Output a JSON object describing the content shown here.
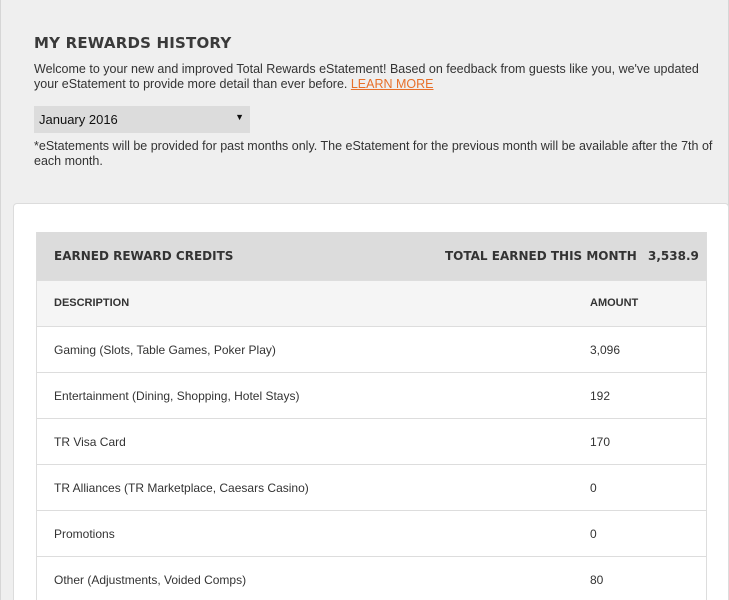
{
  "header": {
    "title": "MY REWARDS HISTORY"
  },
  "intro": {
    "text": "Welcome to your new and improved Total Rewards eStatement! Based on feedback from guests like you, we've updated your eStatement to provide more detail than ever before. ",
    "link_label": "LEARN MORE"
  },
  "month_select": {
    "value": "January 2016",
    "arrow_icon": "caret-down-icon"
  },
  "note": "*eStatements will be provided for past months only. The eStatement for the previous month will be available after the 7th of each month.",
  "earned": {
    "section_title": "EARNED REWARD CREDITS",
    "total_label": "TOTAL EARNED THIS MONTH",
    "total_value": "3,538.9",
    "columns": {
      "description": "DESCRIPTION",
      "amount": "AMOUNT"
    },
    "rows": [
      {
        "description": "Gaming (Slots, Table Games, Poker Play)",
        "amount": "3,096"
      },
      {
        "description": "Entertainment (Dining, Shopping, Hotel Stays)",
        "amount": "192"
      },
      {
        "description": "TR Visa Card",
        "amount": "170"
      },
      {
        "description": "TR Alliances (TR Marketplace, Caesars Casino)",
        "amount": "0"
      },
      {
        "description": "Promotions",
        "amount": "0"
      },
      {
        "description": "Other (Adjustments, Voided Comps)",
        "amount": "80"
      }
    ]
  },
  "colors": {
    "page_bg": "#efefef",
    "link": "#e8702a",
    "table_header_bg": "#dcdcdc"
  }
}
